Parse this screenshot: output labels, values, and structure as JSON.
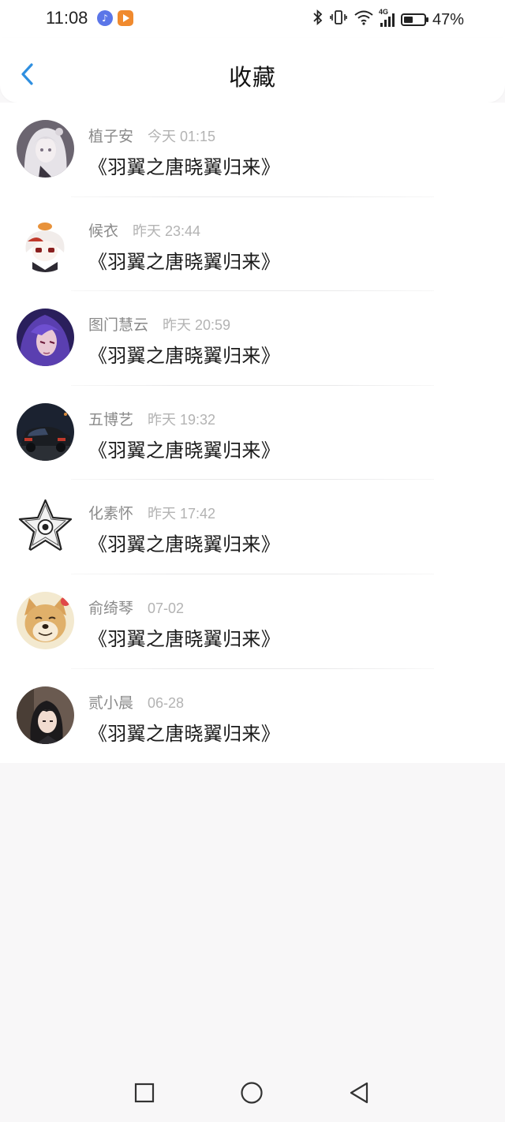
{
  "status_bar": {
    "time": "11:08",
    "battery_percent": "47%",
    "battery_level": 0.47,
    "network": "4G",
    "icons": [
      "music-app-icon",
      "video-app-icon",
      "bluetooth-icon",
      "vibrate-icon",
      "wifi-icon",
      "signal-icon",
      "battery-icon"
    ]
  },
  "header": {
    "title": "收藏",
    "back_icon": "chevron-left-icon",
    "accent_color": "#2f8fe0"
  },
  "items": [
    {
      "user": "植子安",
      "time": "今天 01:15",
      "title": "《羽翼之唐晓翼归来》",
      "avatar": "anime-girl-white-hair"
    },
    {
      "user": "候衣",
      "time": "昨天 23:44",
      "title": "《羽翼之唐晓翼归来》",
      "avatar": "anime-chibi-white-hair"
    },
    {
      "user": "图门慧云",
      "time": "昨天 20:59",
      "title": "《羽翼之唐晓翼归来》",
      "avatar": "anime-purple-hair"
    },
    {
      "user": "五博艺",
      "time": "昨天 19:32",
      "title": "《羽翼之唐晓翼归来》",
      "avatar": "car-night"
    },
    {
      "user": "化素怀",
      "time": "昨天 17:42",
      "title": "《羽翼之唐晓翼归来》",
      "avatar": "star-badge"
    },
    {
      "user": "俞绮琴",
      "time": "07-02",
      "title": "《羽翼之唐晓翼归来》",
      "avatar": "shiba-dog"
    },
    {
      "user": "贰小晨",
      "time": "06-28",
      "title": "《羽翼之唐晓翼归来》",
      "avatar": "anime-dark-hair"
    }
  ],
  "nav": {
    "buttons": [
      "recents-square-icon",
      "home-circle-icon",
      "back-triangle-icon"
    ]
  }
}
